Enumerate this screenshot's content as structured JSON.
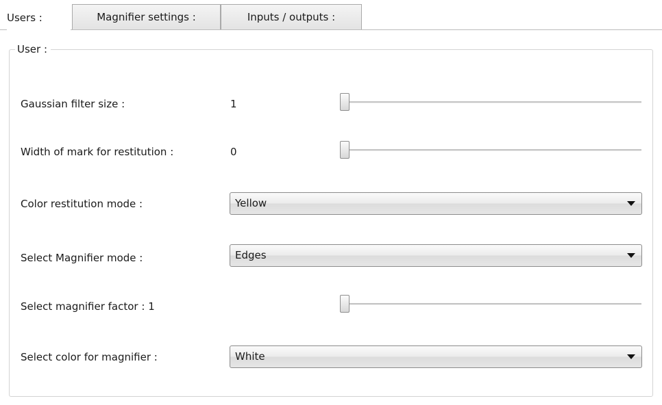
{
  "tabs": [
    {
      "label": "Users :",
      "active": true
    },
    {
      "label": "Magnifier settings :",
      "active": false
    },
    {
      "label": "Inputs / outputs :",
      "active": false
    }
  ],
  "group": {
    "title": "User :"
  },
  "gaussian": {
    "label": "Gaussian filter size :",
    "value": "1",
    "slider_position": 0
  },
  "mark_width": {
    "label": "Width of mark for restitution :",
    "value": "0",
    "slider_position": 0
  },
  "color_restitution": {
    "label": "Color restitution mode :",
    "selected": "Yellow"
  },
  "magnifier_mode": {
    "label": "Select Magnifier mode :",
    "selected": "Edges"
  },
  "magnifier_factor": {
    "label": "Select magnifier factor : 1",
    "slider_position": 0
  },
  "magnifier_color": {
    "label": "Select color for magnifier :",
    "selected": "White"
  },
  "icons": {
    "dropdown": "chevron-down-icon"
  }
}
